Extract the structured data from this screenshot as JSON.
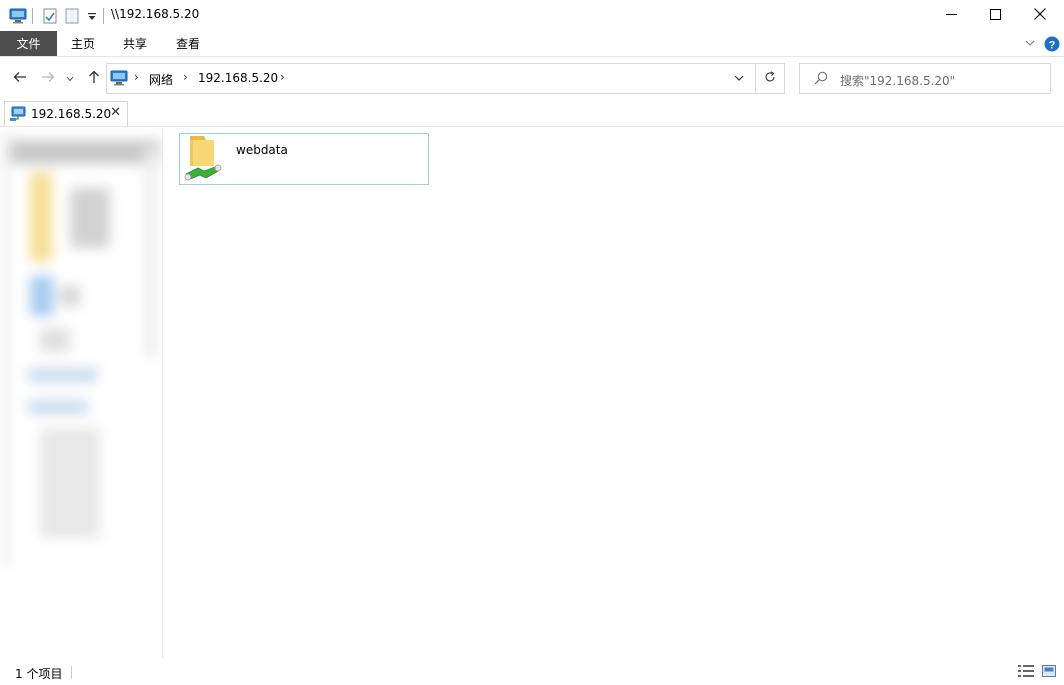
{
  "window": {
    "title": "\\\\192.168.5.20",
    "minimize_icon": "minimize-icon",
    "maximize_icon": "maximize-icon",
    "close_icon": "close-icon"
  },
  "quick_access": {
    "items": [
      "computer-icon",
      "properties-icon",
      "new-folder-icon",
      "customize-dropdown-icon"
    ]
  },
  "ribbon": {
    "tabs": [
      {
        "label": "文件",
        "active": true
      },
      {
        "label": "主页"
      },
      {
        "label": "共享"
      },
      {
        "label": "查看"
      }
    ],
    "help_icon": "help-icon",
    "expand_icon": "chevron-down-icon"
  },
  "nav": {
    "back_icon": "back-arrow-icon",
    "forward_icon": "forward-arrow-icon",
    "recent_icon": "chevron-down-icon",
    "up_icon": "up-arrow-icon"
  },
  "address": {
    "breadcrumbs": [
      "网络",
      "192.168.5.20"
    ],
    "separator": "›",
    "dropdown_icon": "chevron-down-icon",
    "refresh_icon": "refresh-icon"
  },
  "search": {
    "placeholder": "搜索\"192.168.5.20\"",
    "icon": "search-icon"
  },
  "doc_tab": {
    "label": "192.168.5.20",
    "close": "✕"
  },
  "content": {
    "items": [
      {
        "name": "webdata",
        "type": "shared-folder"
      }
    ]
  },
  "status": {
    "item_count": "1 个项目",
    "details_view_icon": "details-view-icon",
    "large-icons_view_icon": "large-icons-view-icon"
  },
  "colors": {
    "file_tab_bg": "#4d4d4d",
    "selection_border": "#99d1dc",
    "help_blue": "#1e6ec8",
    "folder_yellow": "#f5d36b",
    "share_green": "#3fae3f"
  }
}
